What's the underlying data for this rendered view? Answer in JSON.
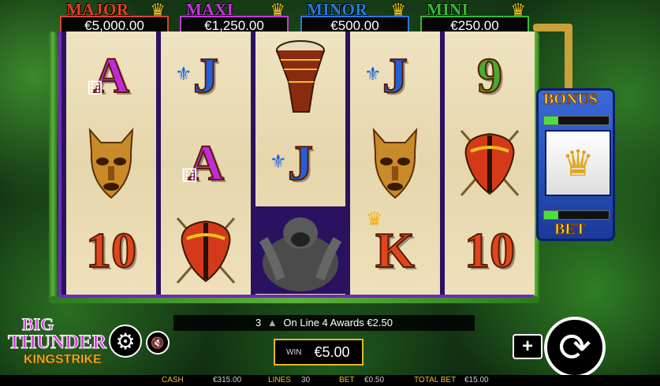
{
  "jackpots": [
    {
      "name": "MAJOR",
      "value": "€5,000.00",
      "color": "#e0402a",
      "border": "#d6452e"
    },
    {
      "name": "MAXI",
      "value": "€1,250.00",
      "color": "#c23ad8",
      "border": "#c23ad8"
    },
    {
      "name": "MINOR",
      "value": "€500.00",
      "color": "#2b78e0",
      "border": "#2b78e0"
    },
    {
      "name": "MINI",
      "value": "€250.00",
      "color": "#3ab838",
      "border": "#3ab838"
    }
  ],
  "reels": [
    [
      {
        "symbol": "A",
        "cls": "A",
        "icon": "dice-icon"
      },
      {
        "symbol": "mask",
        "cls": "mask"
      },
      {
        "symbol": "10",
        "cls": "ten"
      }
    ],
    [
      {
        "symbol": "J",
        "cls": "J",
        "icon": "fleur-de-lis-icon"
      },
      {
        "symbol": "A",
        "cls": "A",
        "icon": "dice-icon"
      },
      {
        "symbol": "shield",
        "cls": "shield"
      }
    ],
    [
      {
        "symbol": "drum",
        "cls": "drum"
      },
      {
        "symbol": "J",
        "cls": "J",
        "icon": "fleur-de-lis-icon"
      },
      {
        "symbol": "gorilla",
        "cls": "gorilla"
      }
    ],
    [
      {
        "symbol": "J",
        "cls": "J",
        "icon": "fleur-de-lis-icon"
      },
      {
        "symbol": "mask",
        "cls": "mask"
      },
      {
        "symbol": "K",
        "cls": "K",
        "icon": "crown-icon"
      }
    ],
    [
      {
        "symbol": "9",
        "cls": "nine"
      },
      {
        "symbol": "shield",
        "cls": "shield"
      },
      {
        "symbol": "10",
        "cls": "ten"
      }
    ]
  ],
  "bonus": {
    "title": "BONUS",
    "bet": "BET"
  },
  "logo": {
    "line1": "BIG",
    "line2": "THUNDER",
    "line3": "KINGSTRIKE"
  },
  "win_message": {
    "count": "3",
    "text": "On Line 4 Awards €2.50"
  },
  "win": {
    "label": "WIN",
    "value": "€5.00"
  },
  "status": {
    "cash_label": "CASH",
    "cash": "€315.00",
    "lines_label": "LINES",
    "lines": "30",
    "bet_label": "BET",
    "bet": "€0.50",
    "total_label": "TOTAL BET",
    "total": "€15.00"
  },
  "icons": {
    "settings": "gear-icon",
    "sound": "sound-off-icon",
    "plus": "plus-icon",
    "spin": "spin-icon"
  }
}
